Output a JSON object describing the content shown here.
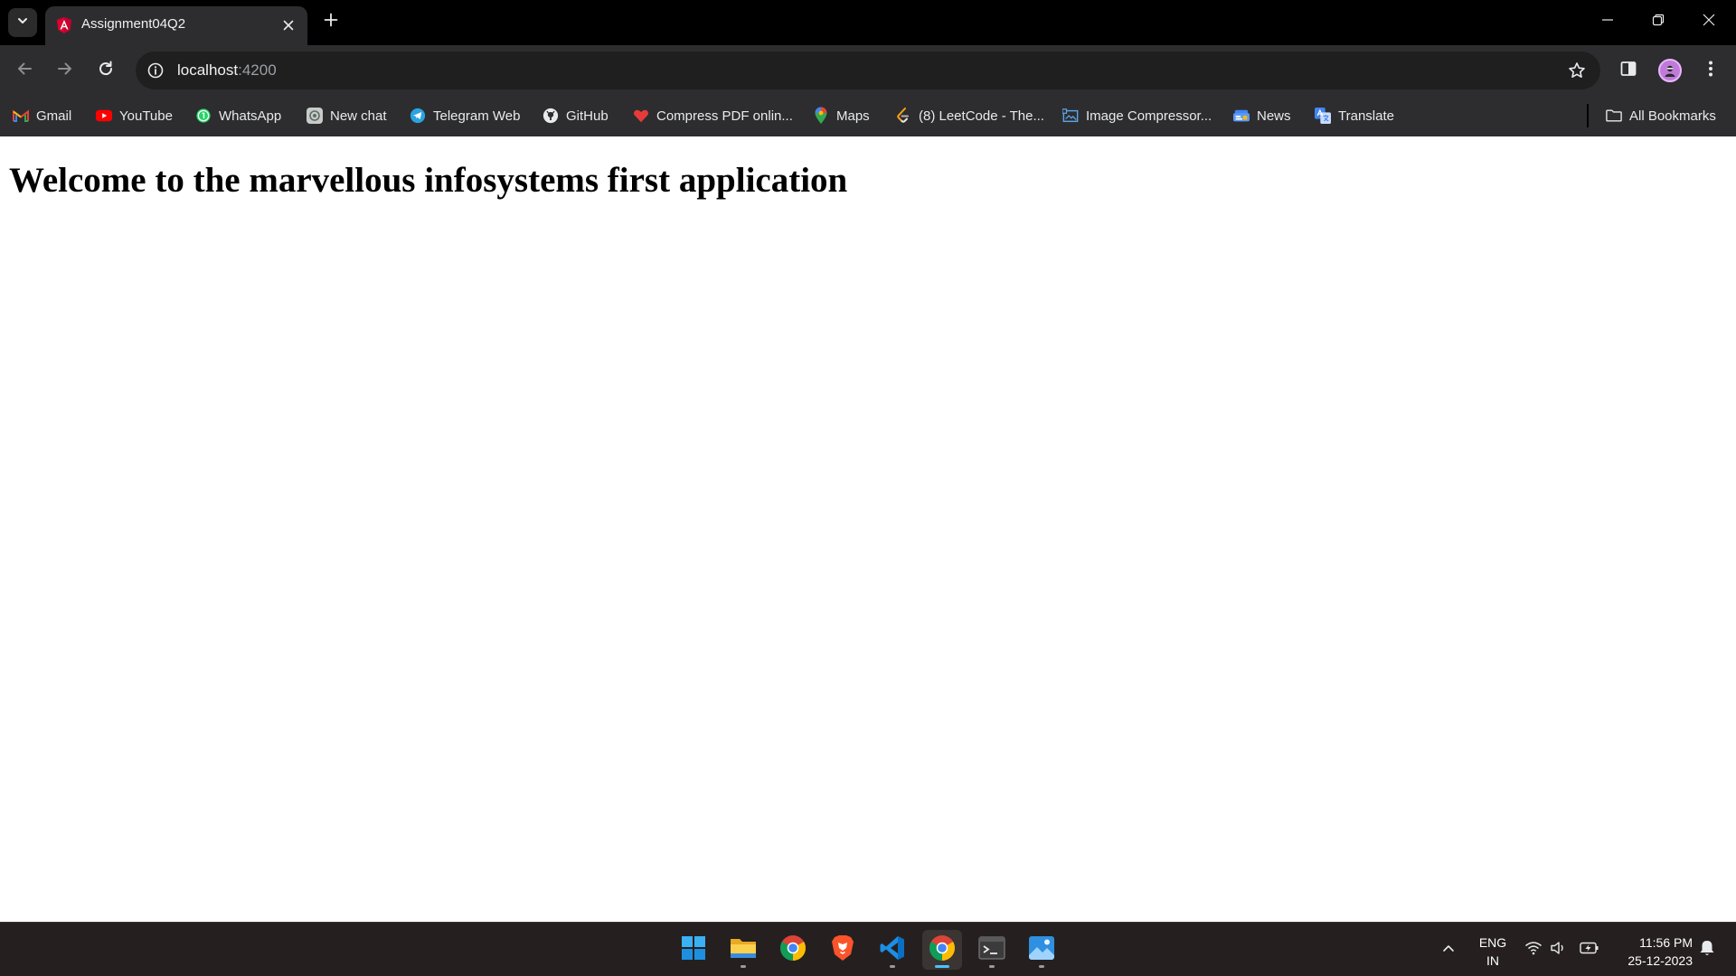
{
  "browser": {
    "tab": {
      "title": "Assignment04Q2"
    },
    "address": {
      "host": "localhost",
      "port": ":4200"
    }
  },
  "bookmarks": [
    {
      "label": "Gmail",
      "icon": "gmail-icon"
    },
    {
      "label": "YouTube",
      "icon": "youtube-icon"
    },
    {
      "label": "WhatsApp",
      "icon": "whatsapp-icon"
    },
    {
      "label": "New chat",
      "icon": "chatgpt-icon"
    },
    {
      "label": "Telegram Web",
      "icon": "telegram-icon"
    },
    {
      "label": "GitHub",
      "icon": "github-icon"
    },
    {
      "label": "Compress PDF onlin...",
      "icon": "pdf-heart-icon"
    },
    {
      "label": "Maps",
      "icon": "maps-pin-icon"
    },
    {
      "label": "(8) LeetCode - The...",
      "icon": "leetcode-icon"
    },
    {
      "label": "Image Compressor...",
      "icon": "image-compressor-icon"
    },
    {
      "label": "News",
      "icon": "news-icon"
    },
    {
      "label": "Translate",
      "icon": "translate-icon"
    }
  ],
  "all_bookmarks": "All Bookmarks",
  "page": {
    "heading": "Welcome to the marvellous infosystems first application"
  },
  "taskbar": {
    "apps": [
      "start-icon",
      "file-explorer-icon",
      "chrome-icon",
      "brave-icon",
      "vscode-icon",
      "chrome-active-icon",
      "terminal-icon",
      "photos-icon"
    ],
    "language": {
      "line1": "ENG",
      "line2": "IN"
    },
    "clock": {
      "time": "11:56 PM",
      "date": "25-12-2023"
    }
  },
  "colors": {
    "tabstrip": "#000000",
    "toolbar": "#2d2d2f",
    "omnibox": "#1f1f1f",
    "taskbar": "#25201f",
    "accent": "#4cc2ff"
  }
}
